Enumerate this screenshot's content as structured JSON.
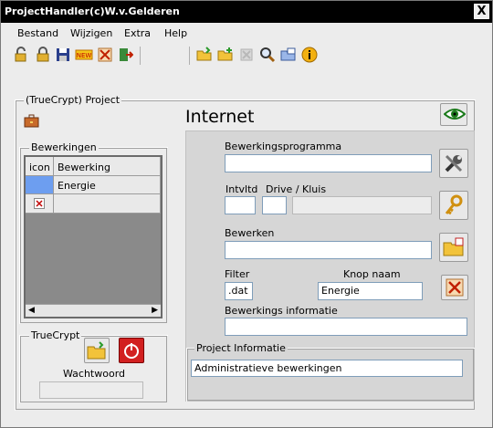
{
  "window": {
    "title": "ProjectHandler(c)W.v.Gelderen",
    "close": "X"
  },
  "menu": [
    "Bestand",
    "Wijzigen",
    "Extra",
    "Help"
  ],
  "project_group": {
    "label": "(TrueCrypt) Project"
  },
  "bewerkingen": {
    "label": "Bewerkingen",
    "columns": [
      "icon",
      "Bewerking"
    ],
    "rows": [
      {
        "value": "Energie"
      }
    ]
  },
  "truecrypt": {
    "label": "TrueCrypt",
    "password_label": "Wachtwoord",
    "password_value": ""
  },
  "detail": {
    "title": "Internet",
    "bewerkingsprogramma_label": "Bewerkingsprogramma",
    "bewerkingsprogramma_value": "",
    "intvltd_label": "Intvltd",
    "drive_label": "Drive / Kluis",
    "bewerken_label": "Bewerken",
    "bewerken_value": "",
    "filter_label": "Filter",
    "filter_value": ".dat",
    "knop_label": "Knop naam",
    "knop_value": "Energie",
    "info_label": "Bewerkings informatie",
    "info_value": "",
    "project_info_label": "Project Informatie",
    "project_info_value": "Administratieve bewerkingen"
  },
  "colors": {
    "selected_cell": "#6d9ef0",
    "accent_red": "#d22020",
    "folder_yellow": "#f2c33a"
  }
}
